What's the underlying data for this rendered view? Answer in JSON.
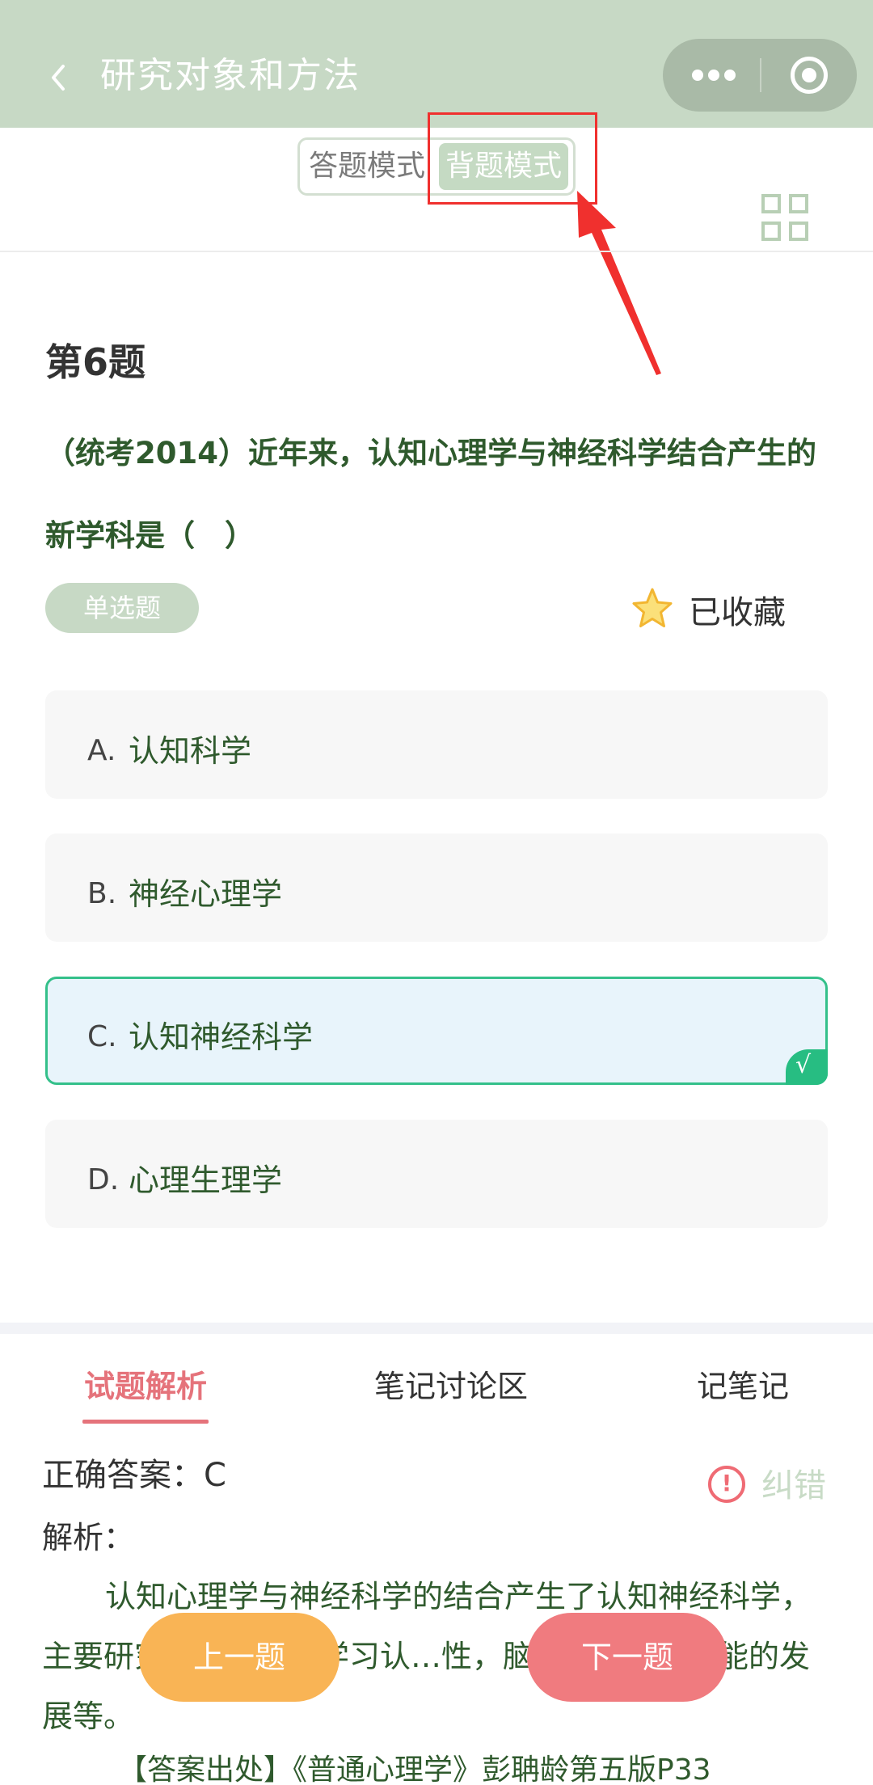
{
  "header": {
    "title": "研究对象和方法"
  },
  "mode_switch": {
    "answer_mode": "答题模式",
    "recite_mode": "背题模式"
  },
  "question": {
    "number": "第6题",
    "text": "（统考2014）近年来，认知心理学与神经科学结合产生的新学科是（　）",
    "type": "单选题",
    "favorite_label": "已收藏",
    "options": [
      {
        "letter": "A.",
        "text": "认知科学"
      },
      {
        "letter": "B.",
        "text": "神经心理学"
      },
      {
        "letter": "C.",
        "text": "认知神经科学",
        "correct": true
      },
      {
        "letter": "D.",
        "text": "心理生理学"
      }
    ],
    "check_mark": "√"
  },
  "tabs": {
    "analysis": "试题解析",
    "discussion": "笔记讨论区",
    "take_note": "记笔记"
  },
  "analysis": {
    "answer": "正确答案：C",
    "report_icon": "!",
    "report_label": "纠错",
    "label": "解析：",
    "body": "认知心理学与神经科学的结合产生了认知神经科学，主要研究…脑机制，学习认…性，脑发育与认知功能的发展等。",
    "source": "【答案出处】《普通心理学》彭聃龄第五版P33"
  },
  "buttons": {
    "prev": "上一题",
    "next": "下一题"
  },
  "colors": {
    "header_bg": "#c7d9c5",
    "primary_text_green": "#2f5a2d",
    "correct_border": "#34c08a",
    "active_tab": "#e5737b",
    "prev_button": "#f9b455",
    "next_button": "#f07b7f",
    "annotation_red": "#f0302e"
  },
  "icons": {
    "back": "chevron-left-icon",
    "more": "more-dots-icon",
    "close": "target-circle-icon",
    "grid": "grid-icon",
    "favorite": "star-icon",
    "report": "exclamation-circle-icon"
  }
}
